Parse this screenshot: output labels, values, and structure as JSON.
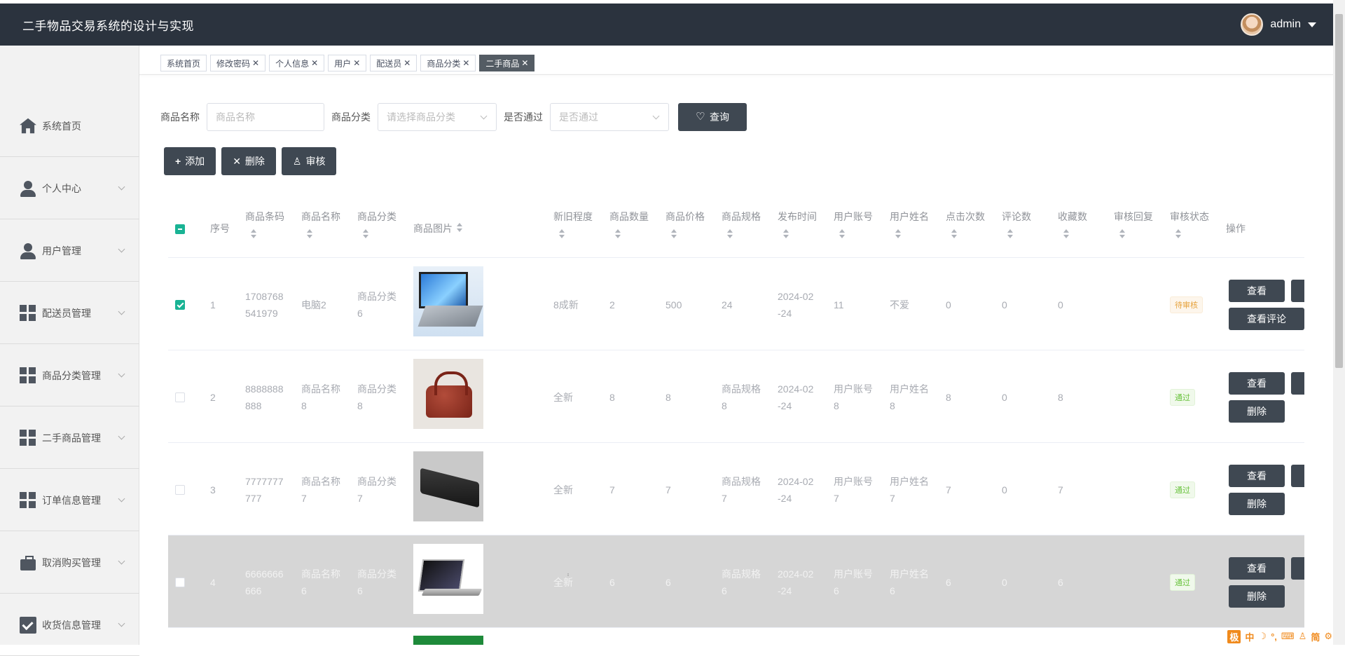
{
  "app": {
    "title": "二手物品交易系统的设计与实现",
    "user": "admin"
  },
  "sidebar": {
    "items": [
      {
        "label": "系统首页",
        "icon": "home-icon",
        "arrow": false
      },
      {
        "label": "个人中心",
        "icon": "user-icon",
        "arrow": true
      },
      {
        "label": "用户管理",
        "icon": "user-icon",
        "arrow": true
      },
      {
        "label": "配送员管理",
        "icon": "grid-icon",
        "arrow": true
      },
      {
        "label": "商品分类管理",
        "icon": "grid-icon",
        "arrow": true
      },
      {
        "label": "二手商品管理",
        "icon": "grid-icon",
        "arrow": true
      },
      {
        "label": "订单信息管理",
        "icon": "grid-icon",
        "arrow": true
      },
      {
        "label": "取消购买管理",
        "icon": "briefcase-icon",
        "arrow": true
      },
      {
        "label": "收货信息管理",
        "icon": "checkbox-icon",
        "arrow": true
      }
    ]
  },
  "tabs": [
    {
      "label": "系统首页",
      "closable": false,
      "active": false
    },
    {
      "label": "修改密码",
      "closable": true,
      "active": false
    },
    {
      "label": "个人信息",
      "closable": true,
      "active": false
    },
    {
      "label": "用户",
      "closable": true,
      "active": false
    },
    {
      "label": "配送员",
      "closable": true,
      "active": false
    },
    {
      "label": "商品分类",
      "closable": true,
      "active": false
    },
    {
      "label": "二手商品",
      "closable": true,
      "active": true
    }
  ],
  "search": {
    "name_label": "商品名称",
    "name_placeholder": "商品名称",
    "category_label": "商品分类",
    "category_placeholder": "请选择商品分类",
    "pass_label": "是否通过",
    "pass_placeholder": "是否通过",
    "query_button": "查询"
  },
  "actions": {
    "add": "添加",
    "delete": "删除",
    "audit": "审核"
  },
  "table": {
    "headers": {
      "index": "序号",
      "barcode": "商品条码",
      "name": "商品名称",
      "category": "商品分类",
      "image": "商品图片",
      "condition": "新旧程度",
      "quantity": "商品数量",
      "price": "商品价格",
      "spec": "商品规格",
      "publish_time": "发布时间",
      "account": "用户账号",
      "username": "用户姓名",
      "clicks": "点击次数",
      "comments": "评论数",
      "favorites": "收藏数",
      "reply": "审核回复",
      "status": "审核状态",
      "ops": "操作"
    },
    "rows": [
      {
        "index": "1",
        "barcode_a": "1708768",
        "barcode_b": "541979",
        "name_a": "电脑2",
        "name_b": "",
        "cat_a": "商品分类",
        "cat_b": "6",
        "image": "laptop",
        "condition": "8成新",
        "quantity": "2",
        "price": "500",
        "spec_a": "24",
        "spec_b": "",
        "time_a": "2024-02",
        "time_b": "-24",
        "acct_a": "11",
        "acct_b": "",
        "user_a": "不爱",
        "user_b": "",
        "clicks": "0",
        "comments": "0",
        "favorites": "0",
        "status": "待审核",
        "op_view": "查看",
        "op_second": "查看评论",
        "checked": true
      },
      {
        "index": "2",
        "barcode_a": "8888888",
        "barcode_b": "888",
        "name_a": "商品名称",
        "name_b": "8",
        "cat_a": "商品分类",
        "cat_b": "8",
        "image": "bag",
        "condition": "全新",
        "quantity": "8",
        "price": "8",
        "spec_a": "商品规格",
        "spec_b": "8",
        "time_a": "2024-02",
        "time_b": "-24",
        "acct_a": "用户账号",
        "acct_b": "8",
        "user_a": "用户姓名",
        "user_b": "8",
        "clicks": "8",
        "comments": "0",
        "favorites": "8",
        "status": "通过",
        "op_view": "查看",
        "op_second": "删除",
        "checked": false
      },
      {
        "index": "3",
        "barcode_a": "7777777",
        "barcode_b": "777",
        "name_a": "商品名称",
        "name_b": "7",
        "cat_a": "商品分类",
        "cat_b": "7",
        "image": "dark",
        "condition": "全新",
        "quantity": "7",
        "price": "7",
        "spec_a": "商品规格",
        "spec_b": "7",
        "time_a": "2024-02",
        "time_b": "-24",
        "acct_a": "用户账号",
        "acct_b": "7",
        "user_a": "用户姓名",
        "user_b": "7",
        "clicks": "7",
        "comments": "0",
        "favorites": "7",
        "status": "通过",
        "op_view": "查看",
        "op_second": "删除",
        "checked": false
      },
      {
        "index": "4",
        "barcode_a": "6666666",
        "barcode_b": "666",
        "name_a": "商品名称",
        "name_b": "6",
        "cat_a": "商品分类",
        "cat_b": "6",
        "image": "mac",
        "condition": "全新",
        "quantity": "6",
        "price": "6",
        "spec_a": "商品规格",
        "spec_b": "6",
        "time_a": "2024-02",
        "time_b": "-24",
        "acct_a": "用户账号",
        "acct_b": "6",
        "user_a": "用户姓名",
        "user_b": "6",
        "clicks": "6",
        "comments": "0",
        "favorites": "6",
        "status": "通过",
        "op_view": "查看",
        "op_second": "删除",
        "checked": false
      }
    ]
  },
  "colors": {
    "topbar": "#2b333e",
    "button": "#3f4852",
    "checkbox": "#19b394",
    "pending": "#e6a23c",
    "pass": "#67c23a"
  }
}
